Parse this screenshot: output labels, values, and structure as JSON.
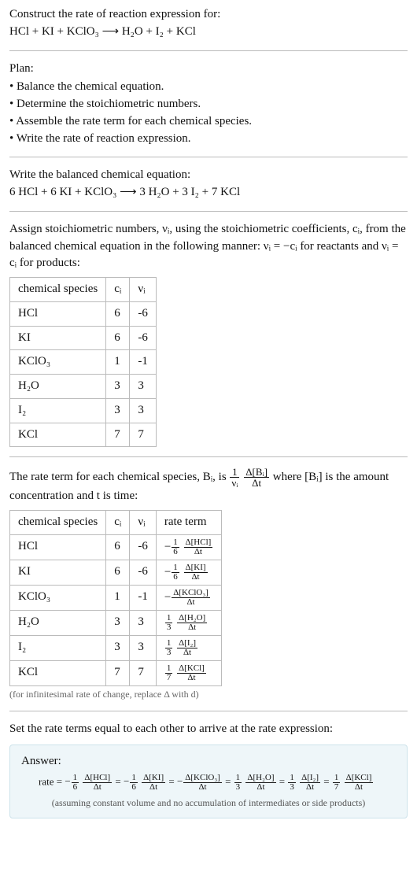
{
  "intro": {
    "title": "Construct the rate of reaction expression for:",
    "equation": "HCl + KI + KClO₃ ⟶ H₂O + I₂ + KCl"
  },
  "plan": {
    "heading": "Plan:",
    "items": [
      "Balance the chemical equation.",
      "Determine the stoichiometric numbers.",
      "Assemble the rate term for each chemical species.",
      "Write the rate of reaction expression."
    ]
  },
  "balanced": {
    "heading": "Write the balanced chemical equation:",
    "equation": "6 HCl + 6 KI + KClO₃ ⟶ 3 H₂O + 3 I₂ + 7 KCl"
  },
  "assign_text_1": "Assign stoichiometric numbers, νᵢ, using the stoichiometric coefficients, cᵢ, from the balanced chemical equation in the following manner: νᵢ = −cᵢ for reactants and νᵢ = cᵢ for products:",
  "table1": {
    "headers": [
      "chemical species",
      "cᵢ",
      "νᵢ"
    ],
    "rows": [
      {
        "sp": "HCl",
        "c": "6",
        "v": "-6"
      },
      {
        "sp": "KI",
        "c": "6",
        "v": "-6"
      },
      {
        "sp": "KClO₃",
        "c": "1",
        "v": "-1"
      },
      {
        "sp": "H₂O",
        "c": "3",
        "v": "3"
      },
      {
        "sp": "I₂",
        "c": "3",
        "v": "3"
      },
      {
        "sp": "KCl",
        "c": "7",
        "v": "7"
      }
    ]
  },
  "rate_term_text_a": "The rate term for each chemical species, Bᵢ, is ",
  "rate_term_text_b": " where [Bᵢ] is the amount concentration and t is time:",
  "table2": {
    "headers": [
      "chemical species",
      "cᵢ",
      "νᵢ",
      "rate term"
    ],
    "rows": [
      {
        "sp": "HCl",
        "c": "6",
        "v": "-6",
        "sign": "−",
        "cnum": "1",
        "cden": "6",
        "dnum": "Δ[HCl]",
        "dden": "Δt"
      },
      {
        "sp": "KI",
        "c": "6",
        "v": "-6",
        "sign": "−",
        "cnum": "1",
        "cden": "6",
        "dnum": "Δ[KI]",
        "dden": "Δt"
      },
      {
        "sp": "KClO₃",
        "c": "1",
        "v": "-1",
        "sign": "−",
        "cnum": "",
        "cden": "",
        "dnum": "Δ[KClO₃]",
        "dden": "Δt"
      },
      {
        "sp": "H₂O",
        "c": "3",
        "v": "3",
        "sign": "",
        "cnum": "1",
        "cden": "3",
        "dnum": "Δ[H₂O]",
        "dden": "Δt"
      },
      {
        "sp": "I₂",
        "c": "3",
        "v": "3",
        "sign": "",
        "cnum": "1",
        "cden": "3",
        "dnum": "Δ[I₂]",
        "dden": "Δt"
      },
      {
        "sp": "KCl",
        "c": "7",
        "v": "7",
        "sign": "",
        "cnum": "1",
        "cden": "7",
        "dnum": "Δ[KCl]",
        "dden": "Δt"
      }
    ]
  },
  "table2_note": "(for infinitesimal rate of change, replace Δ with d)",
  "final_heading": "Set the rate terms equal to each other to arrive at the rate expression:",
  "answer": {
    "label": "Answer:",
    "prefix": "rate = ",
    "terms": [
      {
        "sign": "−",
        "cnum": "1",
        "cden": "6",
        "dnum": "Δ[HCl]",
        "dden": "Δt"
      },
      {
        "sign": "−",
        "cnum": "1",
        "cden": "6",
        "dnum": "Δ[KI]",
        "dden": "Δt"
      },
      {
        "sign": "−",
        "cnum": "",
        "cden": "",
        "dnum": "Δ[KClO₃]",
        "dden": "Δt"
      },
      {
        "sign": "",
        "cnum": "1",
        "cden": "3",
        "dnum": "Δ[H₂O]",
        "dden": "Δt"
      },
      {
        "sign": "",
        "cnum": "1",
        "cden": "3",
        "dnum": "Δ[I₂]",
        "dden": "Δt"
      },
      {
        "sign": "",
        "cnum": "1",
        "cden": "7",
        "dnum": "Δ[KCl]",
        "dden": "Δt"
      }
    ],
    "note": "(assuming constant volume and no accumulation of intermediates or side products)"
  },
  "generic_frac": {
    "n1": "1",
    "nv": "νᵢ",
    "db": "Δ[Bᵢ]",
    "dt": "Δt"
  }
}
